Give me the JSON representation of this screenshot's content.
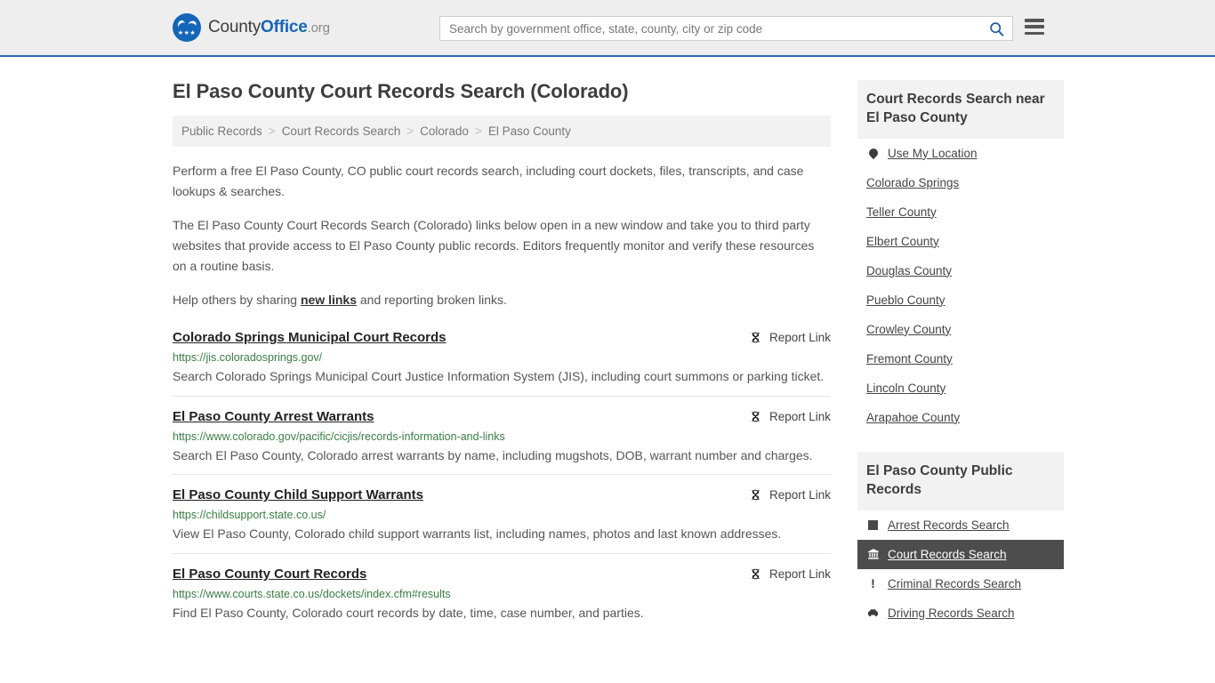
{
  "header": {
    "brand": {
      "part1": "County",
      "part2": "Office",
      "part3": ".org",
      "logo_icon": "eagle-shield-icon"
    },
    "search": {
      "value": "",
      "placeholder": "Search by government office, state, county, city or zip code",
      "button_icon": "search-icon"
    },
    "menu_icon": "hamburger-menu-icon",
    "accent_color": "#1565b8",
    "background_color": "#eeeeee"
  },
  "page": {
    "title": "El Paso County Court Records Search (Colorado)"
  },
  "breadcrumb": {
    "separator": ">",
    "items": [
      {
        "label": "Public Records"
      },
      {
        "label": "Court Records Search"
      },
      {
        "label": "Colorado"
      },
      {
        "label": "El Paso County"
      }
    ]
  },
  "intro": {
    "paragraph1": "Perform a free El Paso County, CO public court records search, including court dockets, files, transcripts, and case lookups & searches.",
    "paragraph2": "The El Paso County Court Records Search (Colorado) links below open in a new window and take you to third party websites that provide access to El Paso County public records. Editors frequently monitor and verify these resources on a routine basis.",
    "paragraph3_before": "Help others by sharing ",
    "paragraph3_link": "new links",
    "paragraph3_after": " and reporting broken links."
  },
  "results": {
    "report_label": "Report Link",
    "report_icon": "broken-link-icon",
    "items": [
      {
        "title": "Colorado Springs Municipal Court Records",
        "url": "https://jis.coloradosprings.gov/",
        "description": "Search Colorado Springs Municipal Court Justice Information System (JIS), including court summons or parking ticket."
      },
      {
        "title": "El Paso County Arrest Warrants",
        "url": "https://www.colorado.gov/pacific/cicjis/records-information-and-links",
        "description": "Search El Paso County, Colorado arrest warrants by name, including mugshots, DOB, warrant number and charges."
      },
      {
        "title": "El Paso County Child Support Warrants",
        "url": "https://childsupport.state.co.us/",
        "description": "View El Paso County, Colorado child support warrants list, including names, photos and last known addresses."
      },
      {
        "title": "El Paso County Court Records",
        "url": "https://www.courts.state.co.us/dockets/index.cfm#results",
        "description": "Find El Paso County, Colorado court records by date, time, case number, and parties."
      }
    ]
  },
  "sidebar": {
    "nearby": {
      "heading": "Court Records Search near El Paso County",
      "items": [
        {
          "label": "Use My Location",
          "icon": "map-pin-icon"
        },
        {
          "label": "Colorado Springs",
          "icon": ""
        },
        {
          "label": "Teller County",
          "icon": ""
        },
        {
          "label": "Elbert County",
          "icon": ""
        },
        {
          "label": "Douglas County",
          "icon": ""
        },
        {
          "label": "Pueblo County",
          "icon": ""
        },
        {
          "label": "Crowley County",
          "icon": ""
        },
        {
          "label": "Fremont County",
          "icon": ""
        },
        {
          "label": "Lincoln County",
          "icon": ""
        },
        {
          "label": "Arapahoe County",
          "icon": ""
        }
      ]
    },
    "public_records": {
      "heading": "El Paso County Public Records",
      "active_color": "#4d4d4d",
      "items": [
        {
          "label": "Arrest Records Search",
          "icon": "handcuffs-square-icon",
          "active": false
        },
        {
          "label": "Court Records Search",
          "icon": "courthouse-icon",
          "active": true
        },
        {
          "label": "Criminal Records Search",
          "icon": "exclamation-icon",
          "active": false
        },
        {
          "label": "Driving Records Search",
          "icon": "car-icon",
          "active": false
        }
      ]
    }
  }
}
